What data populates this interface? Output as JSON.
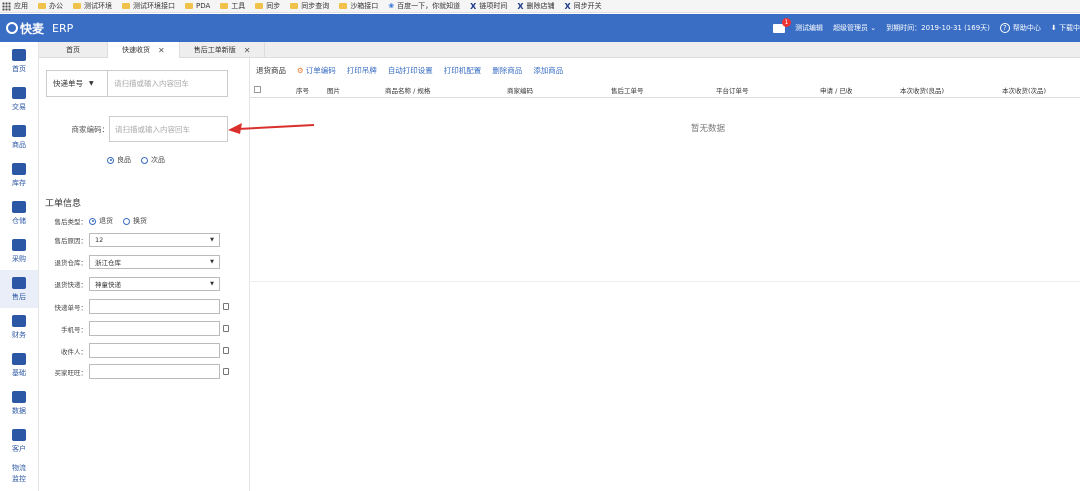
{
  "bookmarks": [
    {
      "label": "应用",
      "icon": "apps-icon"
    },
    {
      "label": "办公",
      "icon": "folder-icon"
    },
    {
      "label": "测试环境",
      "icon": "folder-icon"
    },
    {
      "label": "测试环境接口",
      "icon": "folder-icon"
    },
    {
      "label": "PDA",
      "icon": "folder-icon"
    },
    {
      "label": "工具",
      "icon": "folder-icon"
    },
    {
      "label": "同步",
      "icon": "folder-icon"
    },
    {
      "label": "同步查询",
      "icon": "folder-icon"
    },
    {
      "label": "沙箱接口",
      "icon": "folder-icon"
    },
    {
      "label": "百度一下，你就知道",
      "icon": "paw-icon"
    },
    {
      "label": "链项时间",
      "icon": "x-icon"
    },
    {
      "label": "删除店铺",
      "icon": "x-icon"
    },
    {
      "label": "同步开关",
      "icon": "x-icon"
    }
  ],
  "header": {
    "logo": "快麦",
    "app": "ERP",
    "mail_count": "1",
    "shop": "测试编辑",
    "user": "超级管理员",
    "expire": "到期时间：2019-10-31 (169天)",
    "help": "帮助中心",
    "download": "下载中"
  },
  "sidebar": [
    {
      "label": "首页",
      "icon": "home-icon"
    },
    {
      "label": "交易",
      "icon": "trade-icon"
    },
    {
      "label": "商品",
      "icon": "goods-icon"
    },
    {
      "label": "库存",
      "icon": "stock-icon"
    },
    {
      "label": "仓储",
      "icon": "truck-icon"
    },
    {
      "label": "采购",
      "icon": "cart-icon"
    },
    {
      "label": "售后",
      "icon": "aftersale-icon",
      "active": true
    },
    {
      "label": "财务",
      "icon": "finance-icon"
    },
    {
      "label": "基础",
      "icon": "settings-icon"
    },
    {
      "label": "数据",
      "icon": "chart-icon"
    },
    {
      "label": "客户",
      "icon": "customer-icon"
    },
    {
      "label": "物流监控",
      "icon": "logistics-icon"
    }
  ],
  "tabs": [
    {
      "label": "首页",
      "closable": false
    },
    {
      "label": "快速收货",
      "closable": true,
      "active": true
    },
    {
      "label": "售后工单新版",
      "closable": true
    }
  ],
  "left": {
    "express_select": "快递单号",
    "express_placeholder": "请扫描或输入内容回车",
    "merchant_label": "商家编码：",
    "merchant_placeholder": "请扫描或输入内容回车",
    "quality_options": [
      "良品",
      "次品"
    ],
    "section_title": "工单信息",
    "aftersale_type_label": "售后类型：",
    "aftersale_types": [
      "退货",
      "换货"
    ],
    "reason_label": "售后原因：",
    "reason_value": "12",
    "warehouse_label": "退货仓库：",
    "warehouse_value": "浙江仓库",
    "express_label": "退货快递：",
    "express_value": "神童快递",
    "tracking_label": "快递单号：",
    "phone_label": "手机号：",
    "receiver_label": "收件人：",
    "buyer_label": "买家旺旺："
  },
  "toolbar": {
    "title": "退货商品",
    "buttons": [
      "订单编码",
      "打印吊牌",
      "自动打印设置",
      "打印机配置",
      "删除商品",
      "添加商品"
    ]
  },
  "table": {
    "columns": [
      "序号",
      "图片",
      "商品名称 / 规格",
      "商家编码",
      "售后工单号",
      "平台订单号",
      "申请 / 已收",
      "本次收货(良品)",
      "本次收货(次品)"
    ],
    "empty_text": "暂无数据"
  },
  "colors": {
    "brand": "#3a6ec4",
    "arrow": "#d9302e"
  }
}
